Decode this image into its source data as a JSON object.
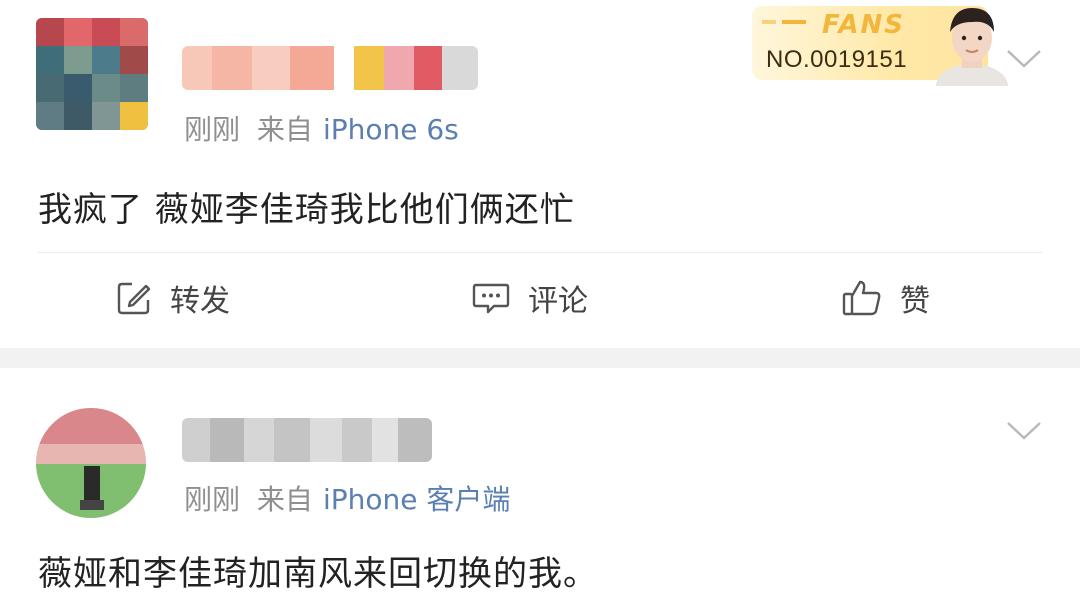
{
  "posts": [
    {
      "time": "刚刚",
      "source_prefix": "来自",
      "source": "iPhone 6s",
      "content": "我疯了 薇娅李佳琦我比他们俩还忙",
      "fans_badge": {
        "title": "FANS",
        "number": "NO.0019151"
      }
    },
    {
      "time": "刚刚",
      "source_prefix": "来自",
      "source": "iPhone 客户端",
      "content": "薇娅和李佳琦加南风来回切换的我。"
    }
  ],
  "actions": {
    "repost": "转发",
    "comment": "评论",
    "like": "赞"
  },
  "icons": [
    "edit-icon",
    "comment-icon",
    "thumbs-up-icon",
    "chevron-down-icon"
  ],
  "colors": {
    "source_link": "#5b7fb0",
    "meta_text": "#8f8f8f",
    "fans_gold": "#f2b63b"
  }
}
